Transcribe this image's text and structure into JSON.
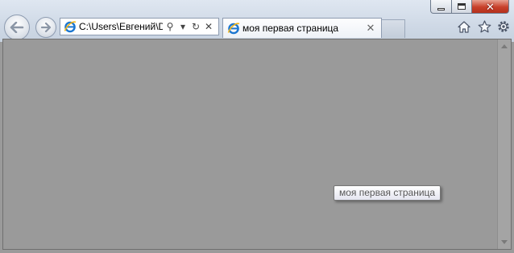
{
  "window": {
    "controls": {
      "minimize_icon": "minimize-icon",
      "maximize_icon": "maximize-icon",
      "close_icon": "close-icon",
      "close_glyph": "✕"
    }
  },
  "navigation": {
    "back_icon": "back-arrow-icon",
    "forward_icon": "forward-arrow-icon"
  },
  "address_bar": {
    "value": "C:\\Users\\Евгений\\D",
    "search_glyph": "⚲",
    "dropdown_glyph": "▾",
    "refresh_glyph": "↻",
    "stop_glyph": "✕"
  },
  "tabs": [
    {
      "title": "моя первая страница",
      "close_glyph": "✕",
      "active": true
    }
  ],
  "command_icons": [
    "home-icon",
    "favorites-star-icon",
    "tools-gear-icon"
  ],
  "content": {
    "background_color": "#9a9a9a",
    "tooltip_text": "моя первая страница"
  },
  "colors": {
    "chrome": "#cfd9e6",
    "close_button": "#c7402a",
    "ie_blue": "#1b76d0",
    "ie_gold": "#f2b51a"
  }
}
